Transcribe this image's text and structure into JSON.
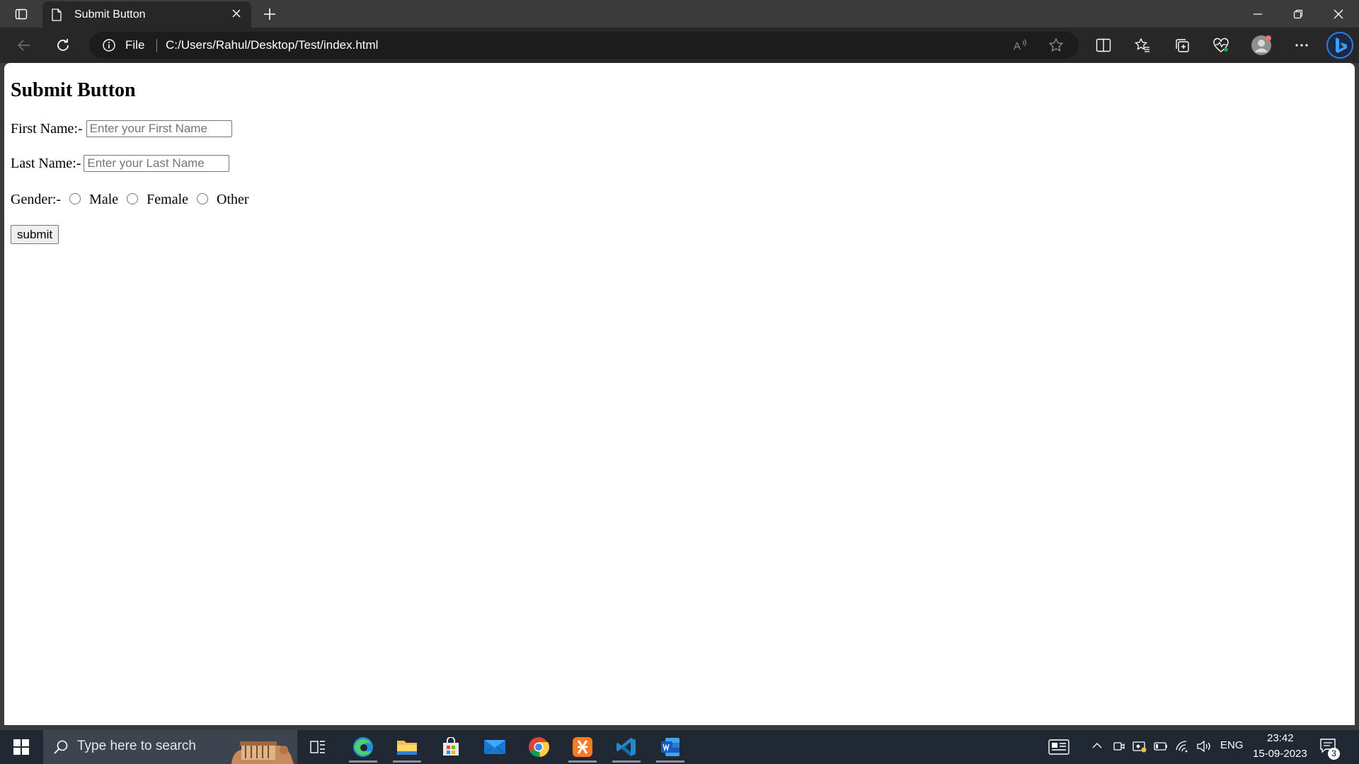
{
  "browser": {
    "tab": {
      "title": "Submit Button"
    },
    "omnibox": {
      "scheme_label": "File",
      "url": "C:/Users/Rahul/Desktop/Test/index.html"
    }
  },
  "page": {
    "heading": "Submit Button",
    "first_name": {
      "label": "First Name:-",
      "placeholder": "Enter your First Name"
    },
    "last_name": {
      "label": "Last Name:-",
      "placeholder": "Enter your Last Name"
    },
    "gender": {
      "label": "Gender:-",
      "options": [
        "Male",
        "Female",
        "Other"
      ]
    },
    "submit_label": "submit"
  },
  "taskbar": {
    "search_placeholder": "Type here to search",
    "language": "ENG",
    "time": "23:42",
    "date": "15-09-2023",
    "notification_count": "3",
    "apps": [
      "task-view",
      "edge",
      "file-explorer",
      "microsoft-store",
      "mail",
      "chrome",
      "xampp",
      "vscode",
      "word"
    ]
  },
  "colors": {
    "titlebar": "#3b3b3b",
    "toolbar": "#272727",
    "omnibox": "#1c1c1c",
    "taskbar": "#202833",
    "edge_blue": "#1a73e8"
  }
}
